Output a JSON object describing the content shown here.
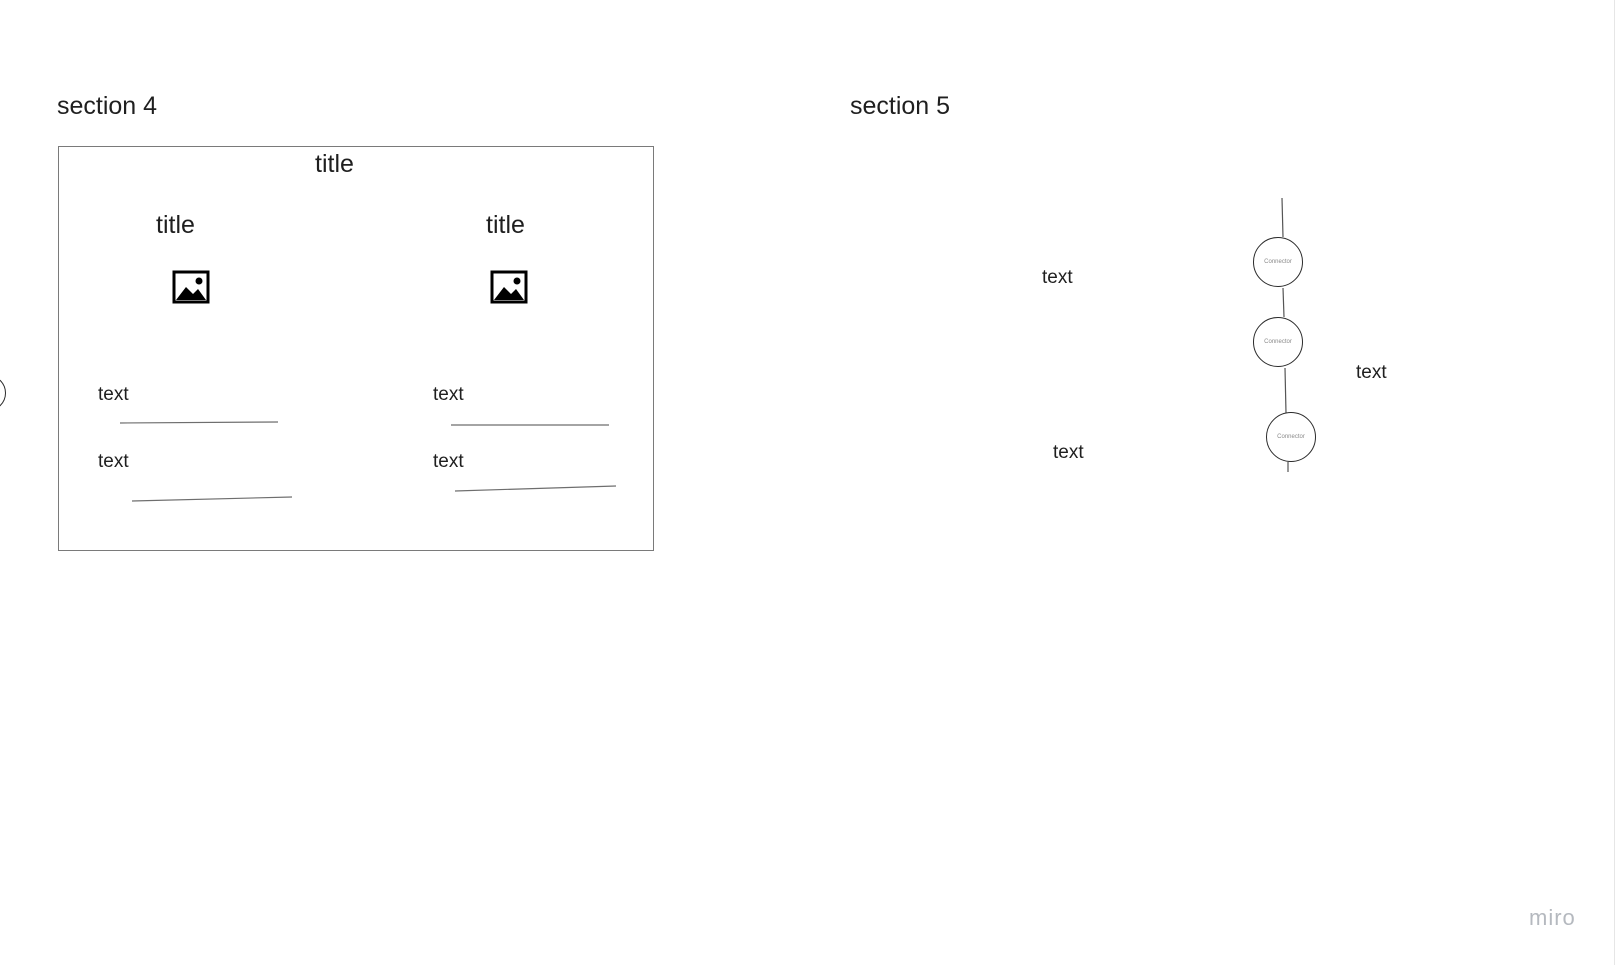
{
  "sections": [
    {
      "title": "section 4"
    },
    {
      "title": "section 5"
    }
  ],
  "section4": {
    "frame_title": "title",
    "columns": [
      {
        "title": "title",
        "image_icon": "image-icon",
        "fields": [
          {
            "label": "text"
          },
          {
            "label": "text"
          }
        ]
      },
      {
        "title": "title",
        "image_icon": "image-icon",
        "fields": [
          {
            "label": "text"
          },
          {
            "label": "text"
          }
        ]
      }
    ]
  },
  "section5": {
    "nodes": [
      {
        "label": "Connector"
      },
      {
        "label": "Connector"
      },
      {
        "label": "Connector"
      }
    ],
    "texts": [
      "text",
      "text",
      "text"
    ]
  },
  "watermark": "miro",
  "colors": {
    "ink": "#1f1f1f",
    "frame_border": "#7a7a7a",
    "watermark": "#b5b9bf"
  }
}
